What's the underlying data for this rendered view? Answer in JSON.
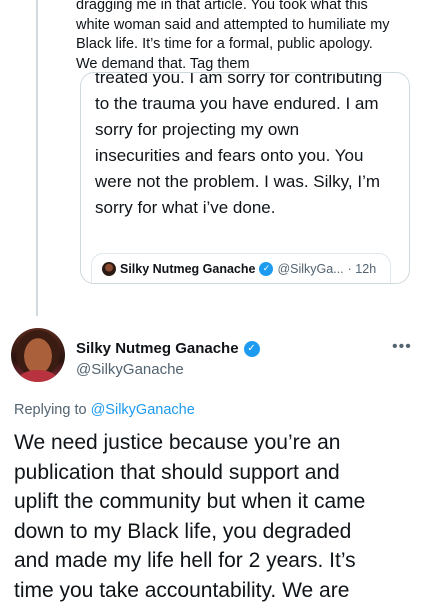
{
  "previous_tweet": {
    "lines": [
      "dragging me in that article. You took what this",
      "white woman said and attempted to humiliate my",
      "Black life. It’s time for a formal, public apology.",
      "We demand that. Tag them"
    ]
  },
  "quoted_tweet": {
    "clipped_line": "treated you. I am sorry for contributing",
    "lines": [
      "to the trauma you have endured. I am",
      "sorry for projecting my own",
      "insecurities and fears onto you. You",
      "were not the problem. I was. Silky, I’m",
      "sorry for what i’ve done."
    ],
    "inner": {
      "name": "Silky Nutmeg Ganache",
      "handle": "@SilkyGa...",
      "time": "· 12h"
    }
  },
  "tweet": {
    "author_name": "Silky Nutmeg Ganache",
    "author_handle": "@SilkyGanache",
    "more_icon": "more-horizontal-icon",
    "replying_to_label": "Replying to",
    "replying_to_handle": "@SilkyGanache",
    "text_lines": [
      "We need justice because you’re an",
      "publication that should support and",
      "uplift the community but when it came",
      "down to my Black life, you degraded",
      "and made my life hell for 2 years. It’s",
      "time you take accountability. We are"
    ]
  },
  "colors": {
    "accent": "#1d9bf0",
    "secondary_text": "#536471",
    "border": "#cfd9de"
  }
}
